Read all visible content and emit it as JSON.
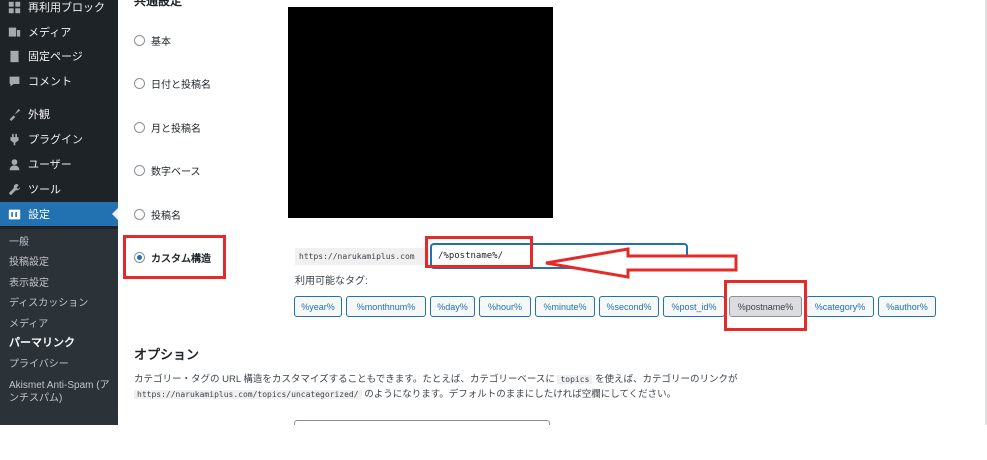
{
  "sidebar": {
    "items": [
      {
        "label": "再利用ブロック",
        "icon": "grid-icon"
      },
      {
        "label": "メディア",
        "icon": "media-icon"
      },
      {
        "label": "固定ページ",
        "icon": "page-icon"
      },
      {
        "label": "コメント",
        "icon": "comment-icon"
      },
      {
        "label": "外観",
        "icon": "appearance-icon"
      },
      {
        "label": "プラグイン",
        "icon": "plugin-icon"
      },
      {
        "label": "ユーザー",
        "icon": "user-icon"
      },
      {
        "label": "ツール",
        "icon": "wrench-icon"
      },
      {
        "label": "設定",
        "icon": "settings-icon"
      }
    ],
    "submenu": [
      "一般",
      "投稿設定",
      "表示設定",
      "ディスカッション",
      "メディア",
      "パーマリンク",
      "プライバシー",
      "Akismet Anti-Spam (アンチスパム)"
    ]
  },
  "permalink": {
    "section_title": "共通設定",
    "options": [
      "基本",
      "日付と投稿名",
      "月と投稿名",
      "数字ベース",
      "投稿名",
      "カスタム構造"
    ],
    "url_prefix": "https://narukamiplus.com",
    "structure_value": "/%postname%/",
    "tags_label": "利用可能なタグ:",
    "tags": [
      "%year%",
      "%monthnum%",
      "%day%",
      "%hour%",
      "%minute%",
      "%second%",
      "%post_id%",
      "%postname%",
      "%category%",
      "%author%"
    ]
  },
  "optional": {
    "title": "オプション",
    "desc_part1": "カテゴリー・タグの URL 構造をカスタマイズすることもできます。たとえば、カテゴリーベースに",
    "desc_code1": "topics",
    "desc_part2": "を使えば、カテゴリーのリンクが",
    "desc_code2": "https://narukamiplus.com/topics/uncategorized/",
    "desc_part3": "のようになります。デフォルトのままにしたければ空欄にしてください。"
  },
  "colors": {
    "highlight": "#e52a2a",
    "accent": "#2271b1",
    "sidebar": "#1d2327"
  }
}
